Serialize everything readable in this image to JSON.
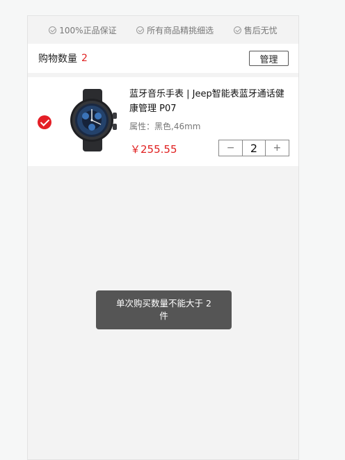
{
  "guarantees": [
    {
      "icon": "check-circle-icon",
      "label": "100%正品保证"
    },
    {
      "icon": "check-circle-icon",
      "label": "所有商品精挑细选"
    },
    {
      "icon": "check-circle-icon",
      "label": "售后无忧"
    }
  ],
  "cart": {
    "count_label": "购物数量",
    "count_value": "2",
    "manage_label": "管理"
  },
  "item": {
    "selected": true,
    "image_icon": "smartwatch-image",
    "title": "蓝牙音乐手表 | Jeep智能表蓝牙通话健康管理 P07",
    "attribute": "属性：黑色,46mm",
    "price": "￥255.55",
    "quantity": "2",
    "minus": "−",
    "plus": "+"
  },
  "toast": {
    "message": "单次购买数量不能大于 2 件"
  },
  "colors": {
    "accent": "#e41e26",
    "price": "#e02020"
  }
}
